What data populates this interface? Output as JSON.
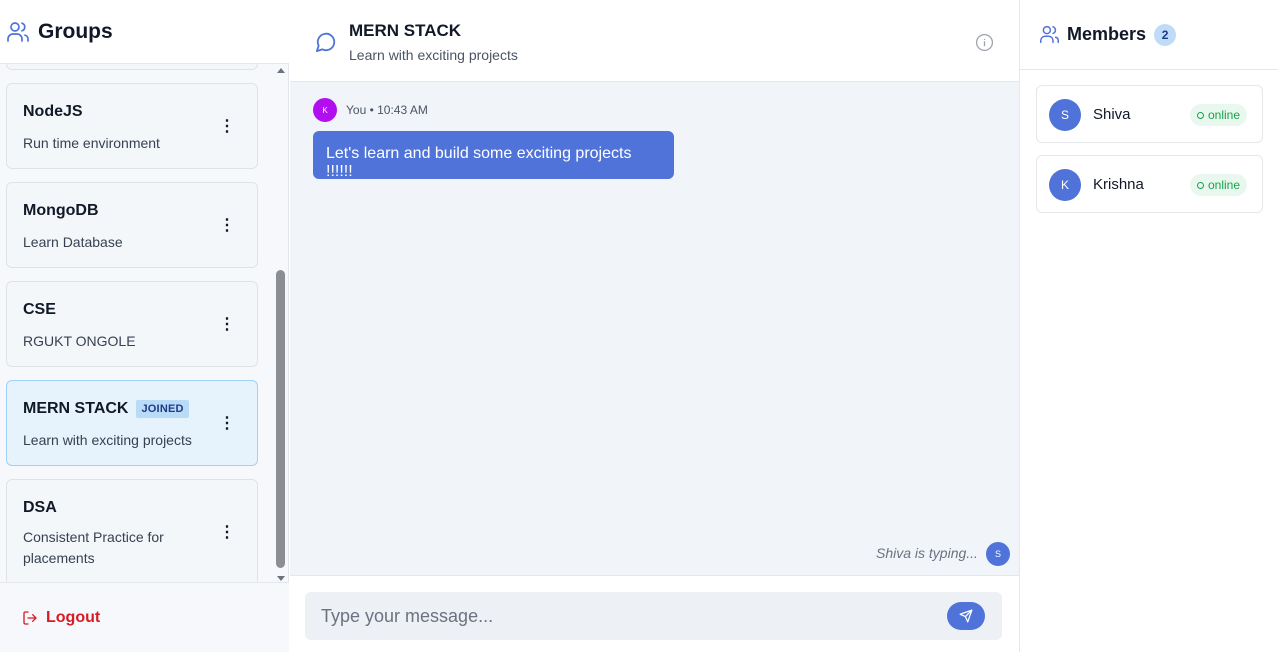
{
  "sidebar": {
    "title": "Groups",
    "groups": [
      {
        "name": "NodeJS",
        "description": "Run time environment",
        "joined": false
      },
      {
        "name": "MongoDB",
        "description": "Learn Database",
        "joined": false
      },
      {
        "name": "CSE",
        "description": "RGUKT ONGOLE",
        "joined": false
      },
      {
        "name": "MERN STACK",
        "description": "Learn with exciting projects",
        "joined": true,
        "badge": "JOINED"
      },
      {
        "name": "DSA",
        "description": "Consistent Practice for placements",
        "joined": false
      }
    ],
    "menu_glyph": "⋮",
    "logout_label": "Logout"
  },
  "chat": {
    "title": "MERN STACK",
    "subtitle": "Learn with exciting projects",
    "messages": [
      {
        "avatar_initial": "K",
        "meta": "You • 10:43 AM",
        "text": "Let's learn and build some exciting projects !!!!!!"
      }
    ],
    "typing_text": "Shiva is typing...",
    "typing_avatar": "S",
    "input_placeholder": "Type your message..."
  },
  "members": {
    "title": "Members",
    "count": "2",
    "list": [
      {
        "initial": "S",
        "name": "Shiva",
        "status": "online"
      },
      {
        "initial": "K",
        "name": "Krishna",
        "status": "online"
      }
    ]
  },
  "icons": {
    "groups": "users-icon",
    "chat": "chat-bubble-icon",
    "info": "info-icon",
    "send": "send-icon",
    "logout": "logout-icon",
    "members": "users-icon"
  },
  "colors": {
    "accent": "#4f73d9",
    "logout": "#d61c24",
    "online": "#16a34a",
    "joined_badge": "#b9dbf6",
    "avatar_you": "#b10ff0"
  }
}
